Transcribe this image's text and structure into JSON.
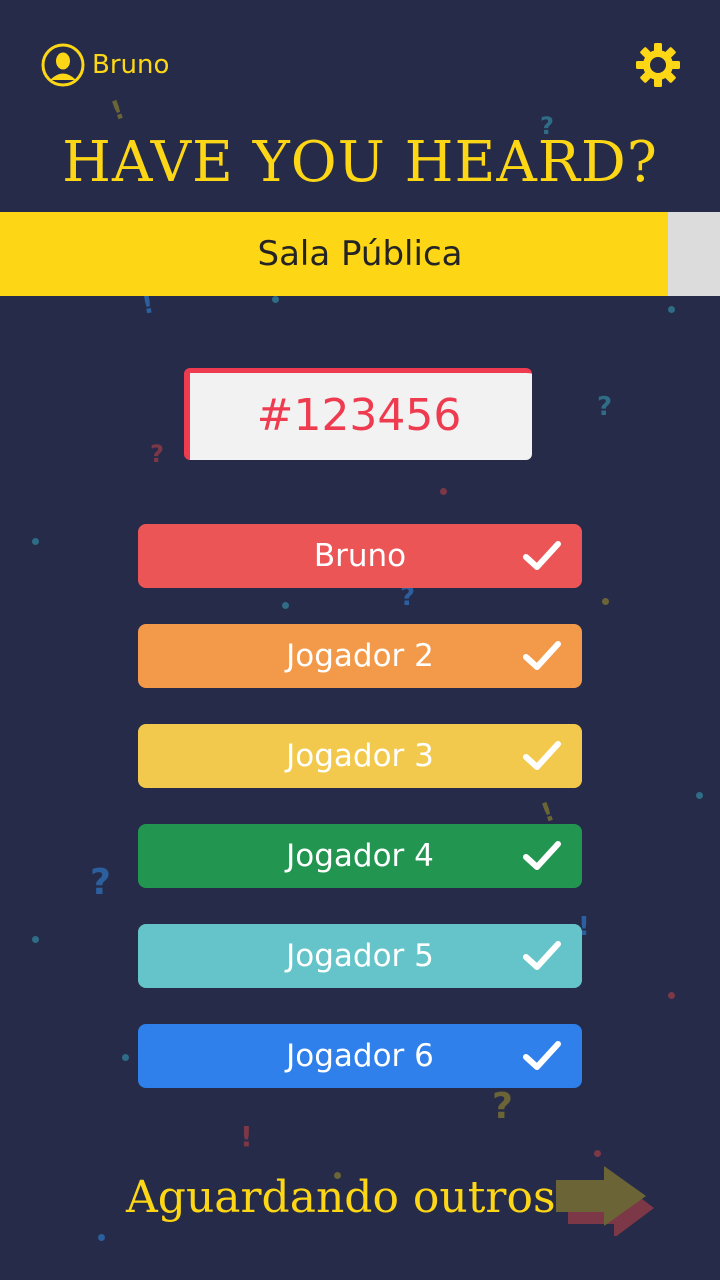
{
  "header": {
    "user_name": "Bruno",
    "avatar_icon": "avatar-icon",
    "settings_icon": "gear-icon",
    "title": "HAVE YOU HEARD?"
  },
  "room": {
    "label": "Sala Pública",
    "code": "#123456"
  },
  "players": [
    {
      "name": "Bruno",
      "color": "#ec5556",
      "ready": true
    },
    {
      "name": "Jogador 2",
      "color": "#f39a4a",
      "ready": true
    },
    {
      "name": "Jogador 3",
      "color": "#f2c94d",
      "ready": true
    },
    {
      "name": "Jogador 4",
      "color": "#229650",
      "ready": true
    },
    {
      "name": "Jogador 5",
      "color": "#65c4c9",
      "ready": true
    },
    {
      "name": "Jogador 6",
      "color": "#2f80eb",
      "ready": true
    }
  ],
  "footer": {
    "status": "Aguardando outros",
    "next_icon": "arrow-right-icon"
  },
  "colors": {
    "background": "#252b48",
    "accent": "#fdd616",
    "code": "#ef3b4f"
  }
}
